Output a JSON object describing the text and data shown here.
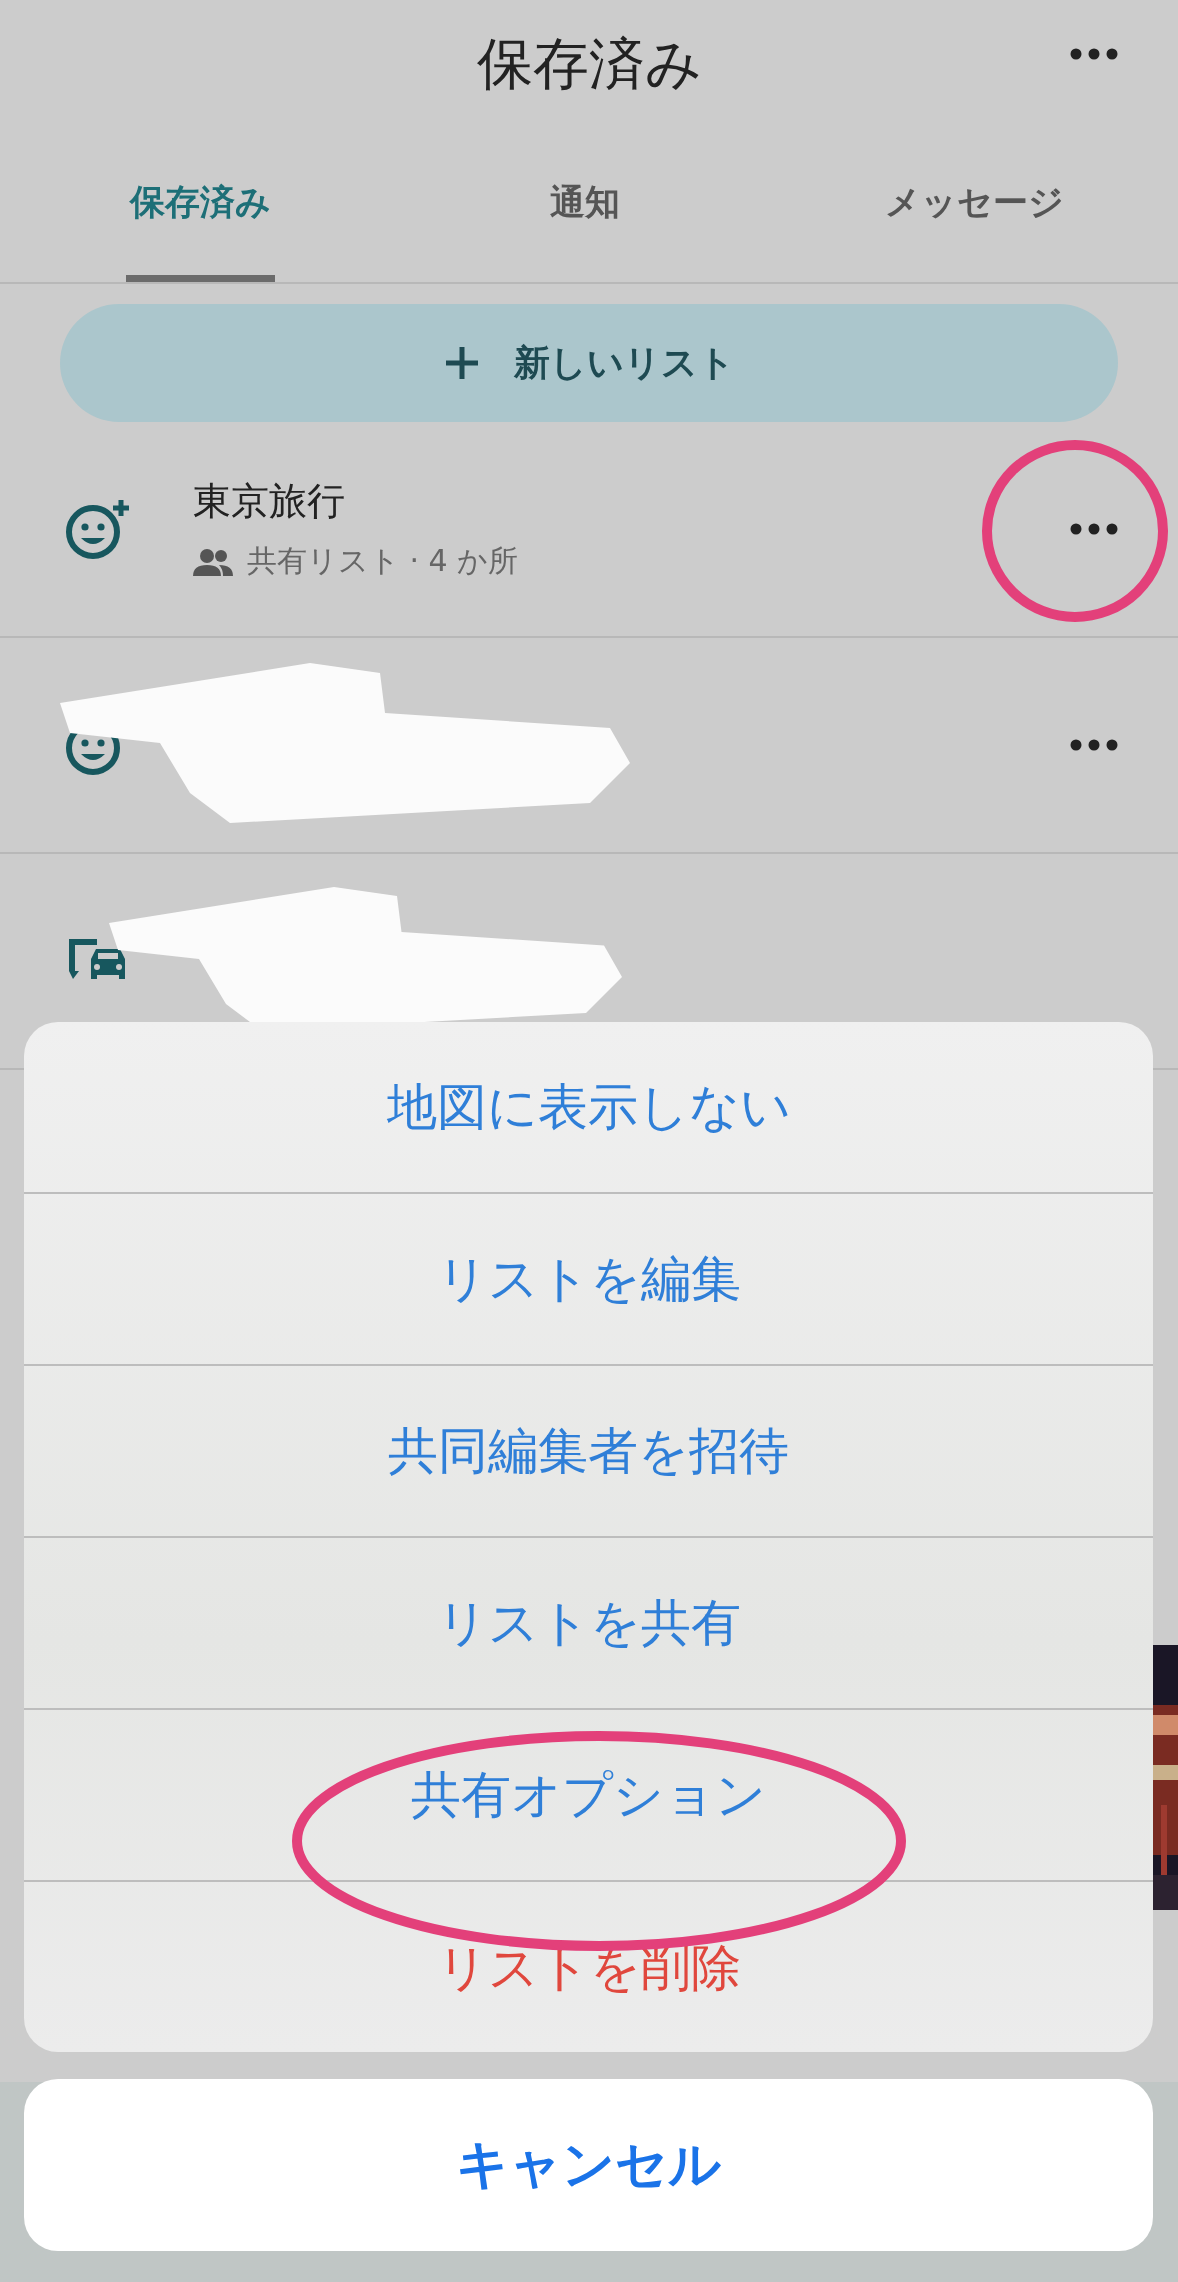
{
  "header": {
    "title": "保存済み"
  },
  "tabs": [
    {
      "label": "保存済み",
      "selected": true
    },
    {
      "label": "通知",
      "selected": false
    },
    {
      "label": "メッセージ",
      "selected": false
    }
  ],
  "new_list_button": {
    "label": "新しいリスト"
  },
  "lists": [
    {
      "kind": "smiley-add",
      "title": "東京旅行",
      "subtitle": "共有リスト · 4 か所",
      "shared": true,
      "menu": true,
      "highlighted": true,
      "redacted": false
    },
    {
      "kind": "smiley",
      "menu": true,
      "highlighted": false,
      "redacted": true
    },
    {
      "kind": "transit",
      "menu": false,
      "highlighted": false,
      "redacted": true
    }
  ],
  "action_sheet": {
    "items": [
      {
        "label": "地図に表示しない",
        "kind": "normal",
        "highlighted": false
      },
      {
        "label": "リストを編集",
        "kind": "normal",
        "highlighted": false
      },
      {
        "label": "共同編集者を招待",
        "kind": "normal",
        "highlighted": false
      },
      {
        "label": "リストを共有",
        "kind": "normal",
        "highlighted": false
      },
      {
        "label": "共有オプション",
        "kind": "normal",
        "highlighted": true
      },
      {
        "label": "リストを削除",
        "kind": "destructive",
        "highlighted": false
      }
    ],
    "cancel": "キャンセル"
  }
}
